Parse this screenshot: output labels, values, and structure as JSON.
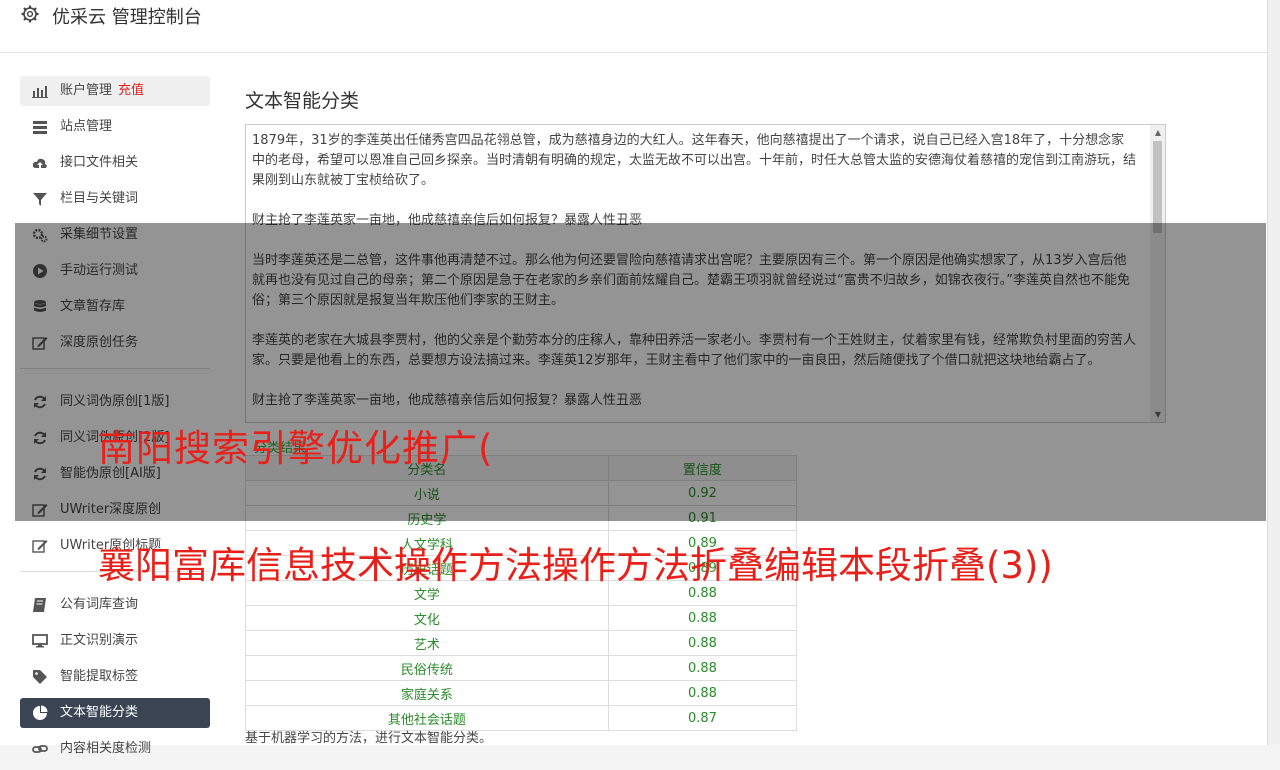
{
  "header": {
    "title": "优采云 管理控制台",
    "icon": "gear-icon"
  },
  "sidebar": {
    "items": [
      {
        "label": "账户管理",
        "badge": "充值",
        "icon": "bar-chart-icon"
      },
      {
        "label": "站点管理",
        "icon": "server-icon"
      },
      {
        "label": "接口文件相关",
        "icon": "cloud-upload-icon"
      },
      {
        "label": "栏目与关键词",
        "icon": "filter-icon"
      },
      {
        "label": "采集细节设置",
        "icon": "cogs-icon"
      },
      {
        "label": "手动运行测试",
        "icon": "play-icon"
      },
      {
        "label": "文章暂存库",
        "icon": "database-icon"
      },
      {
        "label": "深度原创任务",
        "icon": "edit-icon"
      },
      {
        "label": "同义词伪原创[1版]",
        "icon": "refresh-icon"
      },
      {
        "label": "同义词伪原创[2版]",
        "icon": "refresh-icon"
      },
      {
        "label": "智能伪原创[AI版]",
        "icon": "refresh-icon"
      },
      {
        "label": "UWriter深度原创",
        "icon": "edit-icon"
      },
      {
        "label": "UWriter原创标题",
        "icon": "edit-icon"
      },
      {
        "label": "公有词库查询",
        "icon": "book-icon"
      },
      {
        "label": "正文识别演示",
        "icon": "monitor-icon"
      },
      {
        "label": "智能提取标签",
        "icon": "tag-icon"
      },
      {
        "label": "文本智能分类",
        "icon": "pie-chart-icon"
      },
      {
        "label": "内容相关度检测",
        "icon": "link-icon"
      }
    ]
  },
  "main": {
    "title": "文本智能分类",
    "text_paragraphs": [
      "1879年，31岁的李莲英出任储秀宫四品花翎总管，成为慈禧身边的大红人。这年春天，他向慈禧提出了一个请求，说自己已经入宫18年了，十分想念家中的老母，希望可以恩准自己回乡探亲。当时清朝有明确的规定，太监无故不可以出宫。十年前，时任大总管太监的安德海仗着慈禧的宠信到江南游玩，结果刚到山东就被丁宝桢给砍了。",
      "财主抢了李莲英家一亩地，他成慈禧亲信后如何报复？暴露人性丑恶",
      "当时李莲英还是二总管，这件事他再清楚不过。那么他为何还要冒险向慈禧请求出宫呢？主要原因有三个。第一个原因是他确实想家了，从13岁入宫后他就再也没有见过自己的母亲；第二个原因是急于在老家的乡亲们面前炫耀自己。楚霸王项羽就曾经说过“富贵不归故乡，如锦衣夜行。”李莲英自然也不能免俗；第三个原因就是报复当年欺压他们李家的王财主。",
      "李莲英的老家在大城县李贾村，他的父亲是个勤劳本分的庄稼人，靠种田养活一家老小。李贾村有一个王姓财主，仗着家里有钱，经常欺负村里面的穷苦人家。只要是他看上的东西，总要想方设法搞过来。李莲英12岁那年，王财主看中了他们家中的一亩良田，然后随便找了个借口就把这块地给霸占了。",
      "财主抢了李莲英家一亩地，他成慈禧亲信后如何报复？暴露人性丑恶"
    ],
    "result_label": "分类结果",
    "table": {
      "headers": [
        "分类名",
        "置信度"
      ],
      "rows": [
        [
          "小说",
          "0.92"
        ],
        [
          "历史学",
          "0.91"
        ],
        [
          "人文学科",
          "0.89"
        ],
        [
          "历史话题",
          "0.89"
        ],
        [
          "文学",
          "0.88"
        ],
        [
          "文化",
          "0.88"
        ],
        [
          "艺术",
          "0.88"
        ],
        [
          "民俗传统",
          "0.88"
        ],
        [
          "家庭关系",
          "0.88"
        ],
        [
          "其他社会话题",
          "0.87"
        ]
      ]
    },
    "footer_note": "基于机器学习的方法，进行文本智能分类。"
  },
  "overlay": {
    "line1": "南阳搜索引擎优化推广(",
    "line2": "襄阳富库信息技术操作方法操作方法折叠编辑本段折叠(3))"
  },
  "colors": {
    "active_bg": "#3a4453",
    "accent_red": "#e02020",
    "result_green": "#2a8c2a",
    "overlay_text": "#e8201a"
  }
}
